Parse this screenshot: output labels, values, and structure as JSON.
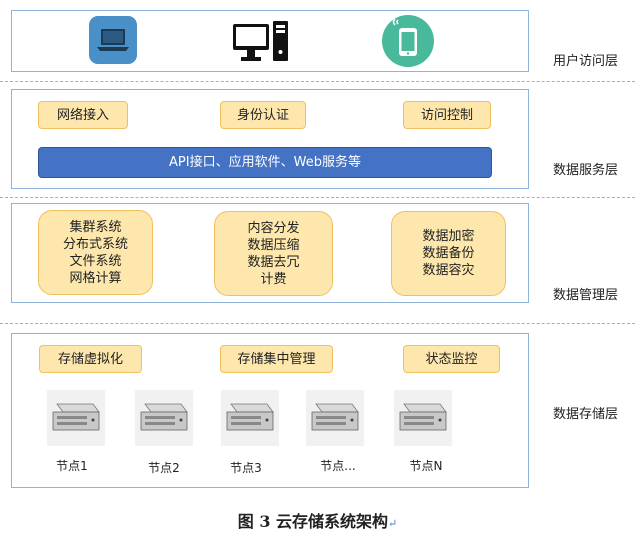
{
  "layers": [
    {
      "id": "user",
      "label": "用户访问层"
    },
    {
      "id": "service",
      "label": "数据服务层"
    },
    {
      "id": "management",
      "label": "数据管理层"
    },
    {
      "id": "storage",
      "label": "数据存储层"
    }
  ],
  "user_layer": {
    "icons": [
      "laptop-icon",
      "desktop-computer-icon",
      "mobile-phone-icon"
    ]
  },
  "service_layer": {
    "tags": [
      "网络接入",
      "身份认证",
      "访问控制"
    ],
    "api_bar": "API接口、应用软件、Web服务等"
  },
  "management_layer": {
    "boxes": [
      [
        "集群系统",
        "分布式系统",
        "文件系统",
        "网格计算"
      ],
      [
        "内容分发",
        "数据压缩",
        "数据去冗",
        "计费"
      ],
      [
        "数据加密",
        "数据备份",
        "数据容灾"
      ]
    ]
  },
  "storage_layer": {
    "tags": [
      "存储虚拟化",
      "存储集中管理",
      "状态监控"
    ],
    "nodes": [
      "节点1",
      "节点2",
      "节点3",
      "节点...",
      "节点N"
    ]
  },
  "caption": {
    "text": "图 3  云存储系统架构",
    "return_mark": "↵"
  },
  "colors": {
    "tag_fill": "#fde7ad",
    "api_fill": "#4472c4",
    "panel_border": "#8fb3d9"
  }
}
